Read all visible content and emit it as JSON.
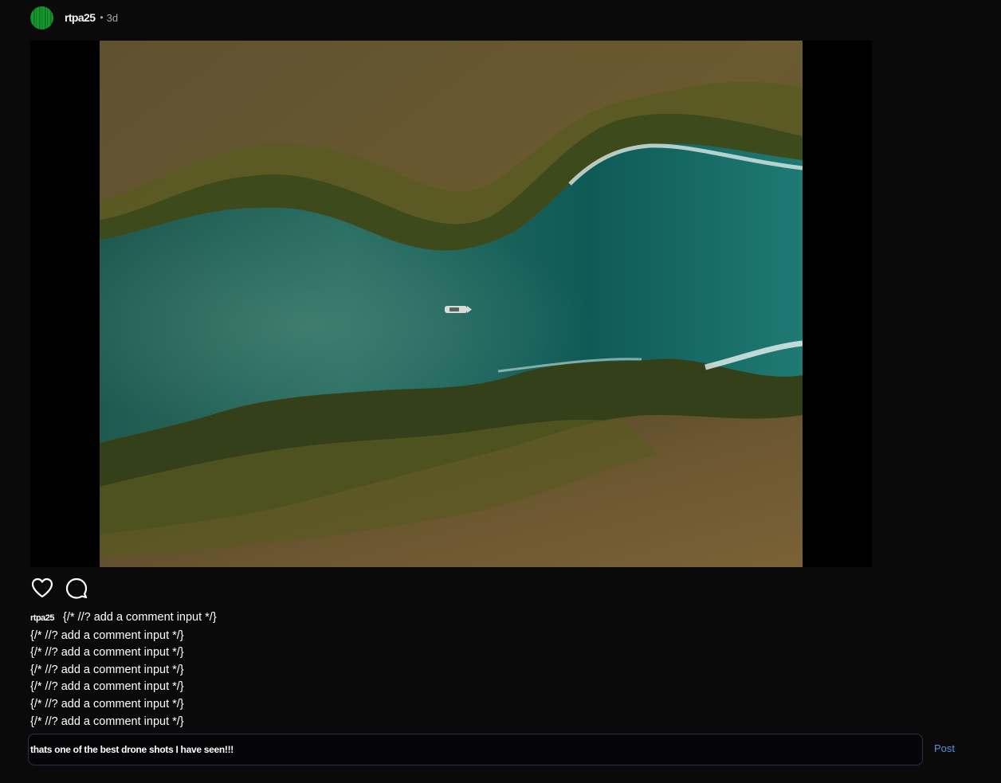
{
  "post": {
    "username": "rtpa25",
    "separator": "•",
    "time_ago": "3d",
    "avatar_icon": "green-striped-avatar",
    "image_description_icon": "aerial-river-photo"
  },
  "actions": {
    "like_icon": "heart-icon",
    "comment_icon": "speech-bubble-icon"
  },
  "caption": {
    "username": "rtpa25",
    "text": "{/* //? add a comment input */}"
  },
  "comments": [
    "{/* //? add a comment input */}",
    "{/* //? add a comment input */}",
    "{/* //? add a comment input */}",
    "{/* //? add a comment input */}",
    "{/* //? add a comment input */}",
    "{/* //? add a comment input */}"
  ],
  "comment_form": {
    "value": "thats one of the best drone shots I have seen!!!",
    "post_label": "Post"
  },
  "colors": {
    "background": "#0a0a0b",
    "accent": "#5e8fd6",
    "input_border": "#25344a",
    "avatar": "#17a233"
  }
}
